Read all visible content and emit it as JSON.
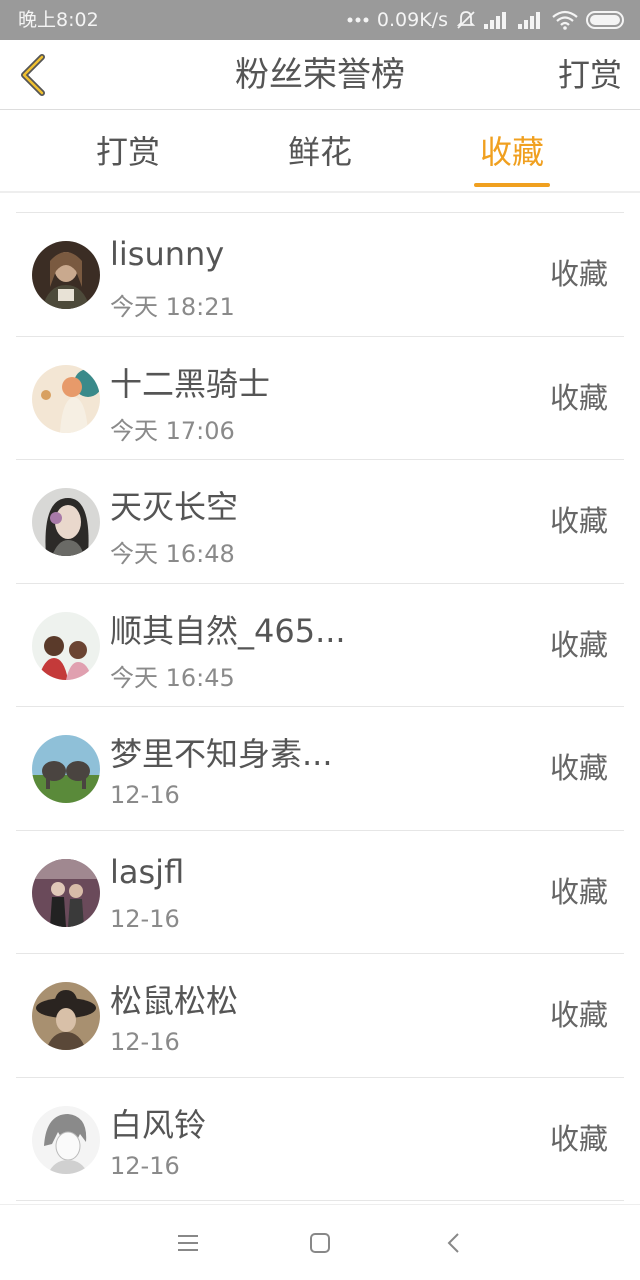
{
  "status_bar": {
    "time": "晚上8:02",
    "network_speed": "0.09K/s"
  },
  "header": {
    "title": "粉丝荣誉榜",
    "action_label": "打赏"
  },
  "tabs": [
    {
      "label": "打赏",
      "active": false
    },
    {
      "label": "鲜花",
      "active": false
    },
    {
      "label": "收藏",
      "active": true
    }
  ],
  "accent_color": "#f0a020",
  "list": [
    {
      "name": "lisunny",
      "time": "今天 18:21",
      "action": "收藏"
    },
    {
      "name": "十二黑骑士",
      "time": "今天 17:06",
      "action": "收藏"
    },
    {
      "name": "天灭长空",
      "time": "今天 16:48",
      "action": "收藏"
    },
    {
      "name": "顺其自然_465...",
      "time": "今天 16:45",
      "action": "收藏"
    },
    {
      "name": "梦里不知身素...",
      "time": "12-16",
      "action": "收藏"
    },
    {
      "name": "lasjfl",
      "time": "12-16",
      "action": "收藏"
    },
    {
      "name": "松鼠松松",
      "time": "12-16",
      "action": "收藏"
    },
    {
      "name": "白风铃",
      "time": "12-16",
      "action": "收藏"
    }
  ]
}
